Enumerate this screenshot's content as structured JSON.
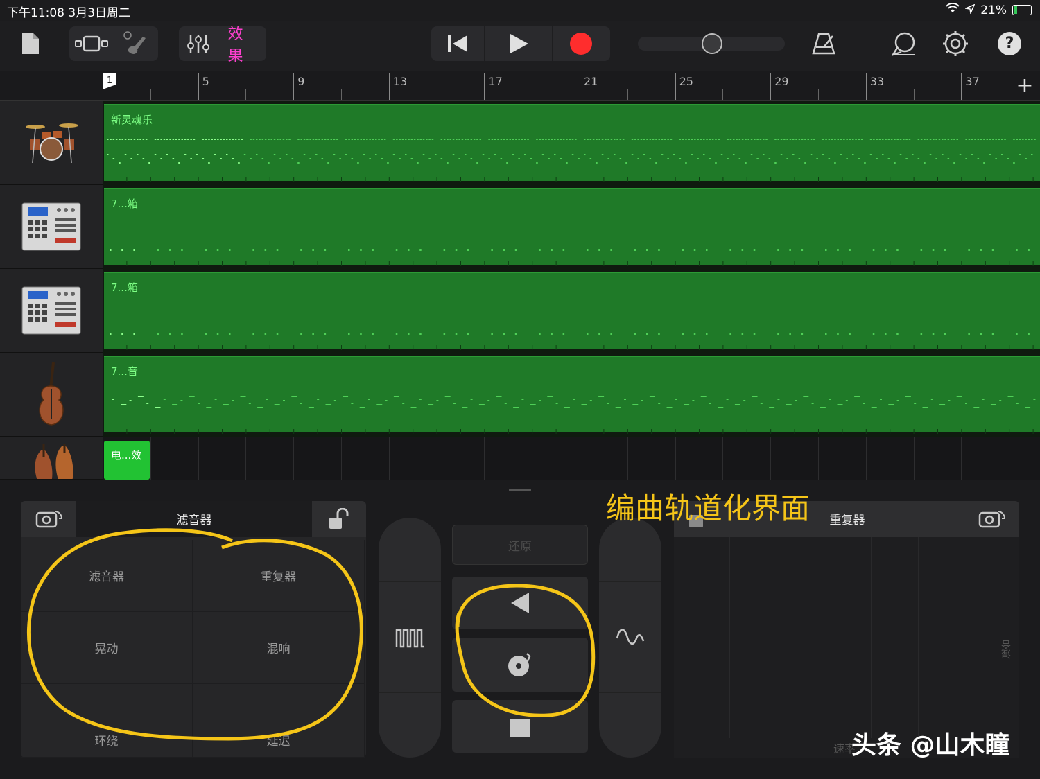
{
  "status": {
    "time_date": "下午11:08   3月3日周二",
    "battery": "21%",
    "battery_level": 0.21
  },
  "toolbar": {
    "effects_label": "效果",
    "icons": [
      "file-icon",
      "view-toggle-icon",
      "instrument-icon",
      "mixer-icon",
      "rewind-icon",
      "play-icon",
      "record-icon",
      "volume-slider",
      "metronome-icon",
      "loop-icon",
      "settings-icon",
      "help-icon"
    ],
    "record_color": "#ff2d2d",
    "help_label": "?",
    "volume_level": 0.5
  },
  "ruler": {
    "bars": [
      "1",
      "5",
      "9",
      "13",
      "17",
      "21",
      "25",
      "29",
      "33",
      "37"
    ],
    "add_label": "+"
  },
  "tracks": [
    {
      "instrument": "drums",
      "region": "新灵魂乐"
    },
    {
      "instrument": "beat-machine",
      "region": "7...箱"
    },
    {
      "instrument": "beat-machine",
      "region": "7...箱"
    },
    {
      "instrument": "bass-violin",
      "region": "7...音"
    },
    {
      "instrument": "strings",
      "region": "电...效"
    }
  ],
  "colors": {
    "region": "#1f7a28",
    "region_label": "#7dff85",
    "annotation": "#f5c518",
    "fx_pink": "#ff3fcf"
  },
  "fx_left": {
    "title": "滤音器",
    "pads": [
      "滤音器",
      "重复器",
      "晃动",
      "混响",
      "环绕",
      "延迟"
    ]
  },
  "center": {
    "restore_label": "还原"
  },
  "fx_right": {
    "title": "重复器",
    "side_label": "混合",
    "speed_label": "速率"
  },
  "annotation": "编曲轨道化界面",
  "watermark": "头条 @山木瞳"
}
